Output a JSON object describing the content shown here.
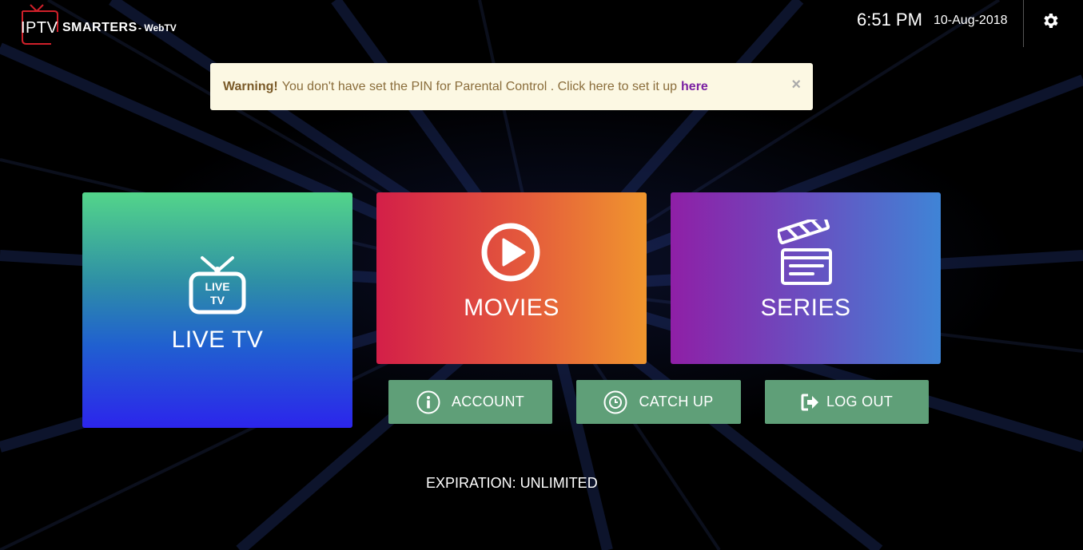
{
  "header": {
    "logo_main": "IPTV",
    "logo_brand": "SMARTERS",
    "logo_sub": "- WebTV",
    "time": "6:51 PM",
    "date": "10-Aug-2018",
    "settings_icon": "gear-icon"
  },
  "alert": {
    "strong": "Warning!",
    "message": "You don't have set the PIN for Parental Control . Click here to set it up",
    "link": "here",
    "close": "×"
  },
  "tiles": {
    "live": {
      "label": "LIVE TV",
      "icon_text_top": "LIVE",
      "icon_text_bottom": "TV",
      "icon": "tv-icon"
    },
    "movies": {
      "label": "MOVIES",
      "icon": "play-circle-icon"
    },
    "series": {
      "label": "SERIES",
      "icon": "clapperboard-icon"
    }
  },
  "buttons": {
    "account": {
      "label": "ACCOUNT",
      "icon": "info-icon"
    },
    "catchup": {
      "label": "CATCH UP",
      "icon": "clock-icon"
    },
    "logout": {
      "label": "LOG OUT",
      "icon": "sign-out-icon"
    }
  },
  "expiration": "EXPIRATION: UNLIMITED",
  "colors": {
    "button_green": "#5f9f78",
    "alert_bg": "#fcf8e3",
    "link_purple": "#7a1fa2"
  }
}
